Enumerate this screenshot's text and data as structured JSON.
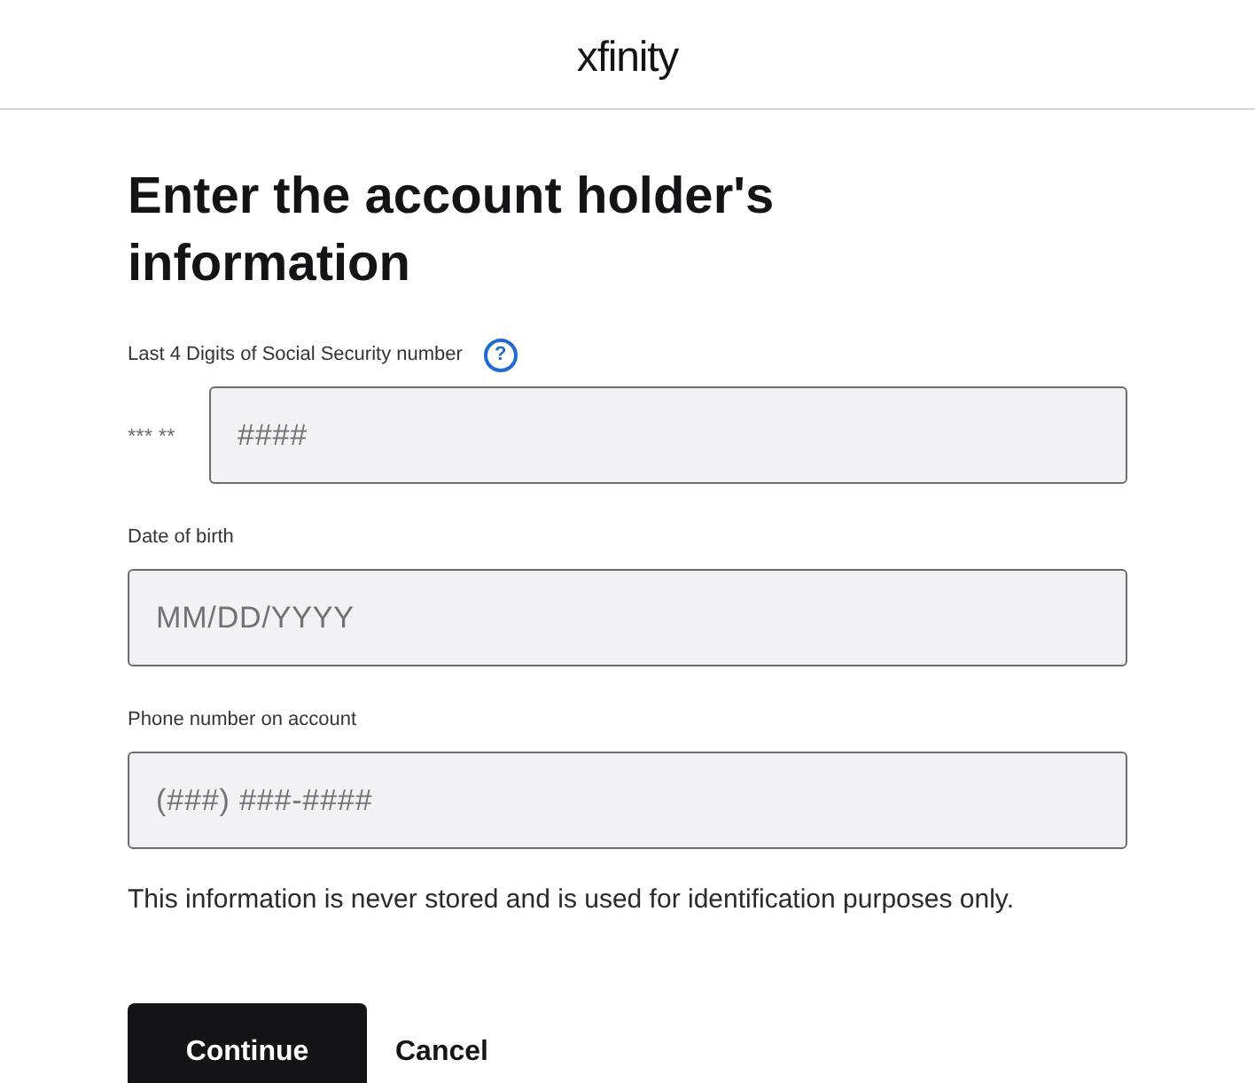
{
  "header": {
    "logo": "xfinity"
  },
  "title": "Enter the account holder's information",
  "fields": [
    {
      "kind": "masked",
      "label": "Last 4 Digits of Social Security number",
      "help": "?",
      "prefix": "*** **",
      "placeholder": "####"
    },
    {
      "kind": "plain",
      "label": "Date of birth",
      "placeholder": "MM/DD/YYYY"
    },
    {
      "kind": "plain",
      "label": "Phone number on account",
      "placeholder": "(###) ###-####"
    }
  ],
  "note": "This information is never stored and is used for identification purposes only.",
  "buttons": {
    "primary": "Continue",
    "secondary": "Cancel"
  }
}
